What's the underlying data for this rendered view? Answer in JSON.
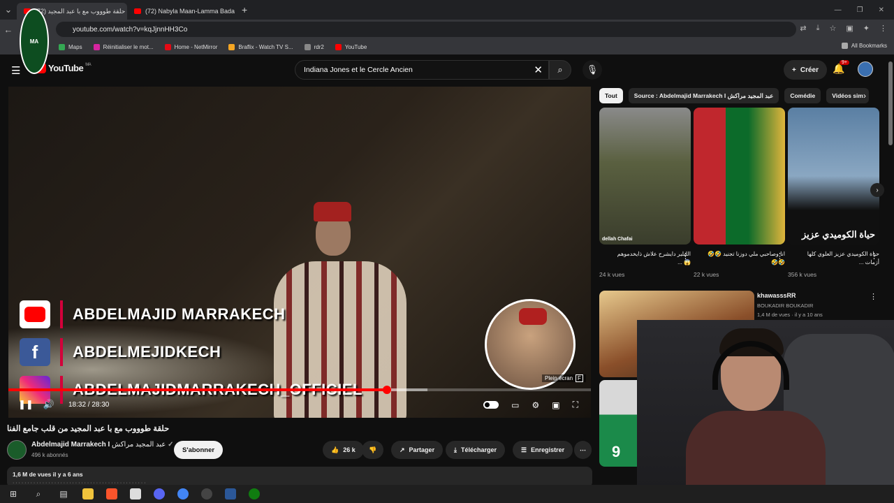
{
  "browser": {
    "tabs": [
      {
        "title": "(72) حلقة طوووب مع با عبد المجيد",
        "active": true
      },
      {
        "title": "(72) Nabyla Maan-Lamma Bada",
        "active": false
      }
    ],
    "url": "youtube.com/watch?v=kqJjnnHH3Co",
    "bookmarks": [
      "Maps",
      "Réinitialiser le mot...",
      "Home - NetMirror",
      "Braflix - Watch TV S...",
      "rdr2",
      "YouTube"
    ],
    "all_bookmarks": "All Bookmarks"
  },
  "youtube": {
    "logo_text": "YouTube",
    "logo_region": "MA",
    "search_value": "Indiana Jones et le Cercle Ancien",
    "create_label": "Créer",
    "notif_badge": "9+"
  },
  "player": {
    "social": {
      "youtube": "ABDELMAJID MARRAKECH",
      "facebook": "ABDELMEJIDKECH",
      "instagram": "ABDELMAJIDMARRAKECH_OFFICIEL"
    },
    "current_time": "18:32",
    "duration": "28:30",
    "time_display": "18:32 / 28:30",
    "progress_fraction": 0.65,
    "loaded_fraction": 0.72,
    "tooltip": "Plein écran",
    "tooltip_key": "F"
  },
  "video": {
    "title": "حلقة طوووب مع با عبد المجيد من قلب جامع الفنا",
    "channel_name": "Abdelmajid Marrakech I",
    "channel_name_ar": "عبد المجيد مراكش",
    "subscribers": "496 k abonnés",
    "subscribe_label": "S'abonner",
    "likes": "26 k",
    "share_label": "Partager",
    "download_label": "Télécharger",
    "save_label": "Enregistrer",
    "views_date": "1,6 M de vues  il y a 6 ans"
  },
  "sidebar": {
    "chips": [
      "Tout",
      "Source : Abdelmajid Marrakech I عبد المجيد مراكش",
      "Comédie",
      "Vidéos sim"
    ],
    "shorts": [
      {
        "title": "الليلير دايشرح علاش ذايخدموهم 😱 ...",
        "views": "24 k vues",
        "caption": "dellah Chafai"
      },
      {
        "title": "انا وصاحبي ملي دوزنا تجنيد 🤣🤣🤣🤣",
        "views": "22 k vues",
        "caption": ""
      },
      {
        "title": "حياة الكوميدي عزيز العلوي كلها أزمات ...",
        "views": "356 k vues",
        "caption": "حياة الكوميدي عزيز"
      }
    ],
    "recs": [
      {
        "title": "khawasssRR",
        "channel": "BOUKADIR BOUKADIR",
        "meta": "1,4 M de vues · il y a 10 ans"
      },
      {
        "title": "",
        "channel": "",
        "meta": ""
      }
    ]
  },
  "colors": {
    "bg": "#0f0f0f",
    "accent": "#ff0000",
    "chip_active": "#f1f1f1"
  }
}
